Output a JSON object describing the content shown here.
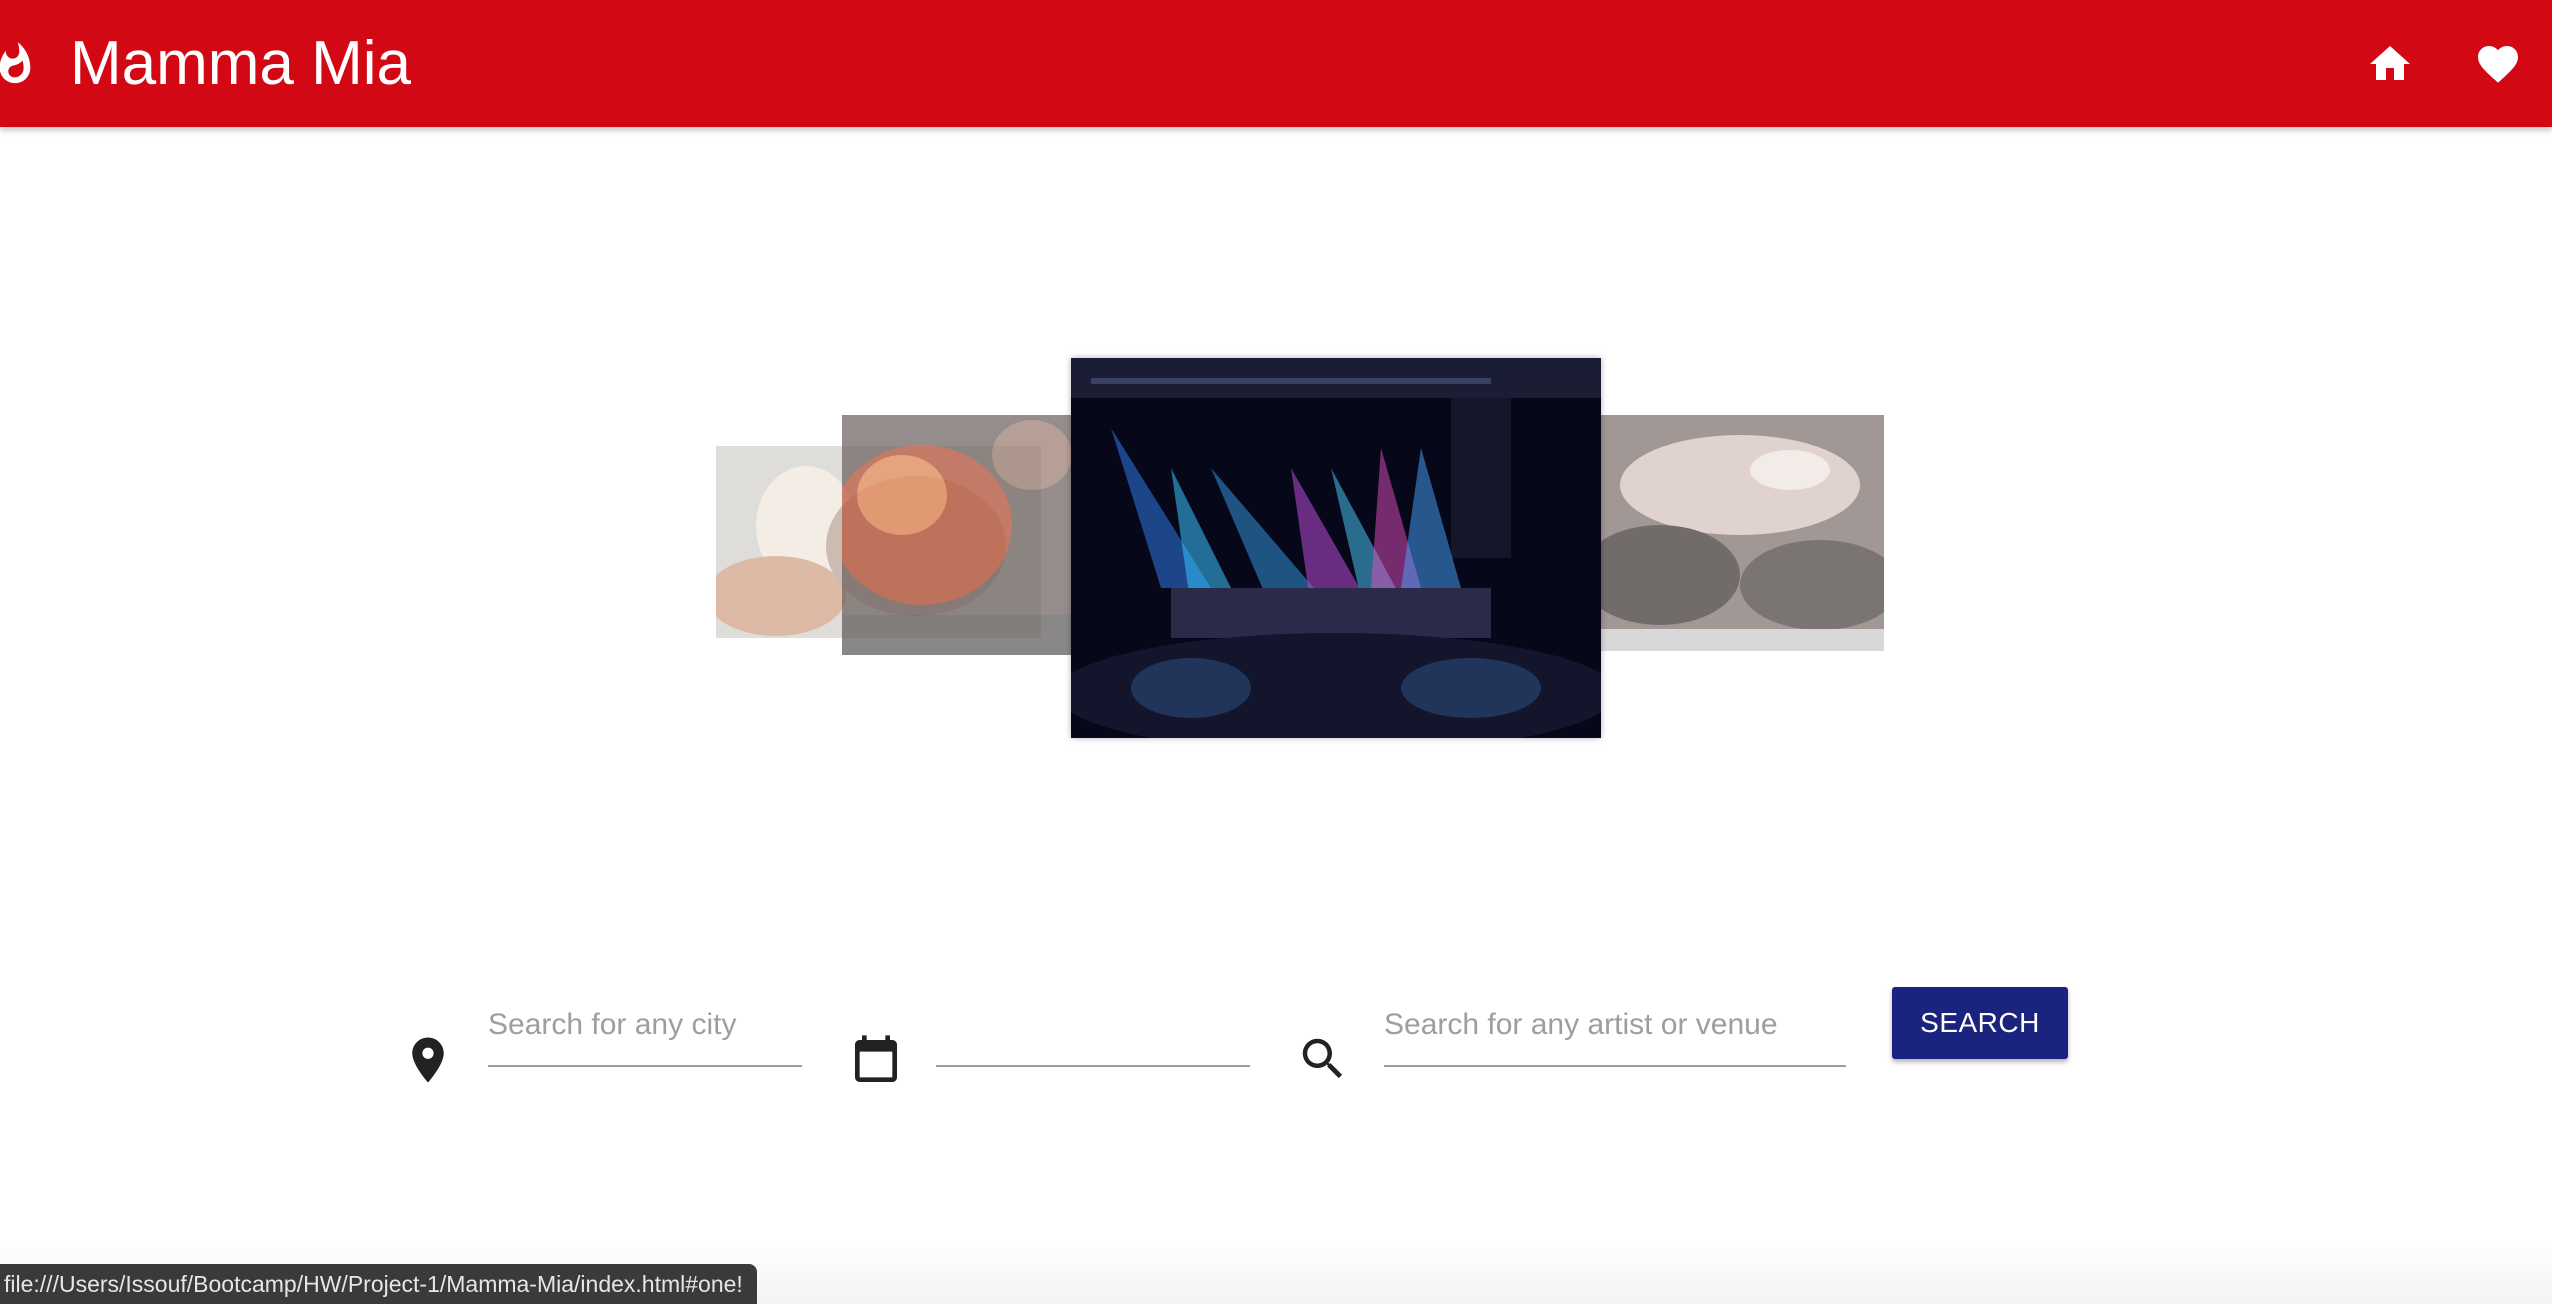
{
  "header": {
    "title": "Mamma Mia",
    "brand_icon": "fire-icon",
    "home_icon": "home-icon",
    "favorites_icon": "heart-icon",
    "color": "#d20915"
  },
  "carousel": {
    "items": [
      {
        "name": "carousel-item-1",
        "image": "concert-photo"
      },
      {
        "name": "carousel-item-2",
        "image": "concert-photo"
      },
      {
        "name": "carousel-item-3",
        "image": "concert-photo"
      },
      {
        "name": "carousel-item-4",
        "image": "concert-photo"
      }
    ]
  },
  "search": {
    "city_placeholder": "Search for any city",
    "date_value": "",
    "artist_placeholder": "Search for any artist or venue",
    "button_label": "SEARCH",
    "button_color": "#1a237e",
    "icons": [
      "location-pin-icon",
      "calendar-icon",
      "search-icon"
    ]
  },
  "status_bar": {
    "url": "file:///Users/Issouf/Bootcamp/HW/Project-1/Mamma-Mia/index.html#one!"
  }
}
